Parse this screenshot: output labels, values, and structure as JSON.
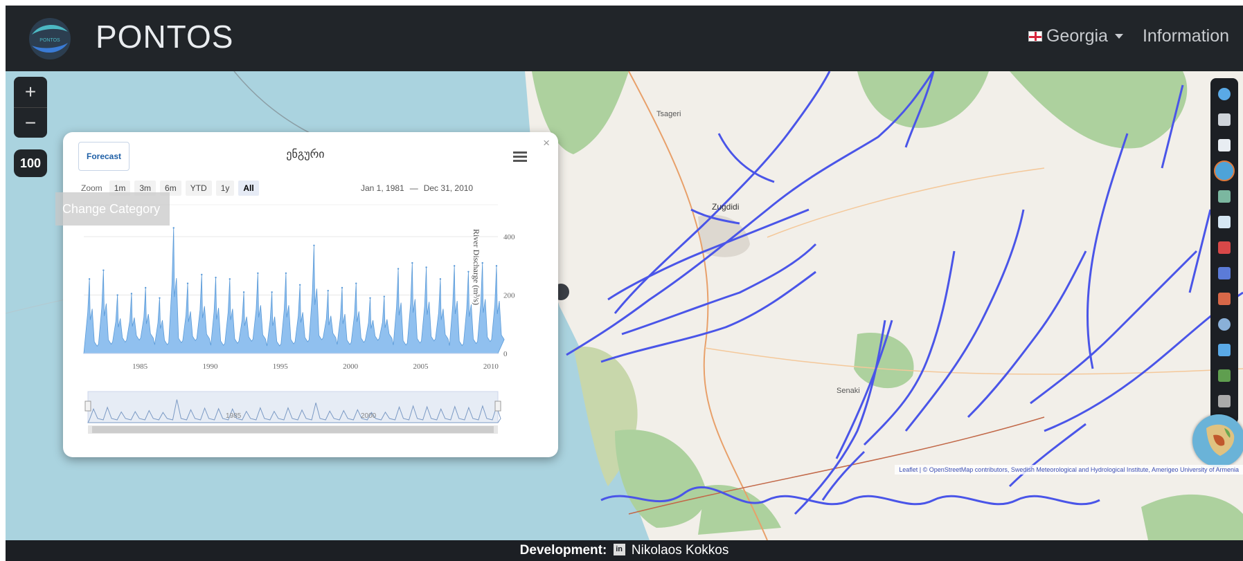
{
  "app": {
    "title": "PONTOS",
    "logo_text": "PONTOS"
  },
  "nav": {
    "country_label": "Georgia",
    "information_label": "Information",
    "flag_icon": "georgia-flag-icon"
  },
  "map_controls": {
    "zoom_in": "+",
    "zoom_out": "−",
    "scale_value": "100",
    "change_category": "Change Category"
  },
  "popup": {
    "close": "×",
    "forecast_button": "Forecast",
    "chart_title": "ენგური",
    "range_label": "Zoom",
    "range_buttons": [
      "1m",
      "3m",
      "6m",
      "YTD",
      "1y",
      "All"
    ],
    "active_range": "All",
    "date_from": "Jan 1, 1981",
    "date_sep": "—",
    "date_to": "Dec 31, 2010",
    "navigator_labels": [
      "1985",
      "2000"
    ]
  },
  "chart_data": {
    "type": "area",
    "title": "ენგური",
    "ylabel": "River Discharge (m³/s)",
    "x_ticks": [
      "1985",
      "1990",
      "1995",
      "2000",
      "2005",
      "2010"
    ],
    "y_ticks": [
      "0",
      "200",
      "400"
    ],
    "ylim": [
      0,
      450
    ],
    "xlim": [
      1981,
      2010
    ],
    "series": [
      {
        "x": [
          1981.4,
          1982.4,
          1983.4,
          1984.4,
          1985.4,
          1986.4,
          1987.4,
          1988.4,
          1989.4,
          1990.4,
          1991.4,
          1992.4,
          1993.4,
          1994.4,
          1995.4,
          1996.4,
          1997.4,
          1998.4,
          1999.4,
          2000.4,
          2001.4,
          2002.4,
          2003.4,
          2004.4,
          2005.4,
          2006.4,
          2007.4,
          2008.4,
          2009.4,
          2010.4
        ],
        "values": [
          255,
          285,
          200,
          205,
          225,
          190,
          430,
          240,
          270,
          260,
          255,
          210,
          275,
          210,
          275,
          235,
          370,
          215,
          225,
          240,
          190,
          195,
          290,
          310,
          295,
          255,
          300,
          280,
          310,
          300
        ]
      }
    ]
  },
  "map_labels": [
    "Tsageri",
    "Zugdidi",
    "Senaki"
  ],
  "attribution": "Leaflet | © OpenStreetMap contributors, Swedish Meteorological and Hydrological Institute, Amerigeo University of Armenia",
  "layer_icons": [
    "basin-icon",
    "mountain-icon",
    "glacier-icon",
    "water-drop-icon",
    "flood-icon",
    "snow-icon",
    "thermometer-icon",
    "precipitation-icon",
    "drought-icon",
    "sea-level-icon",
    "wind-icon",
    "vegetation-icon",
    "network-icon"
  ],
  "footer": {
    "label": "Development:",
    "linkedin_icon": "in",
    "name": "Nikolaos Kokkos"
  },
  "colors": {
    "navbar": "#212529",
    "river": "#4a55e8",
    "series": "#7cb5ec",
    "sea": "#aad3df"
  }
}
